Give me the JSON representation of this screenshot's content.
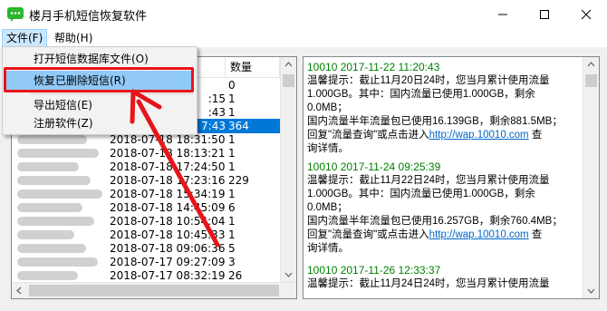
{
  "window": {
    "title": "楼月手机短信恢复软件",
    "accent": "#0078d7",
    "app_icon": "chat-bubble-icon"
  },
  "menubar": {
    "file": "文件(F)",
    "help": "帮助(H)"
  },
  "file_menu": {
    "items": [
      {
        "label": "打开短信数据库文件(O)"
      },
      {
        "label": "恢复已删除短信(R)"
      },
      {
        "label": "导出短信(E)"
      },
      {
        "label": "注册软件(Z)"
      }
    ]
  },
  "list": {
    "count_header": "数量",
    "rows": [
      {
        "date": "",
        "count": "0"
      },
      {
        "date": ":15",
        "count": "1"
      },
      {
        "date": ":43",
        "count": "1"
      },
      {
        "date": "7:43",
        "count": "364"
      },
      {
        "date": "2018-07-18 18:31:50",
        "count": "1"
      },
      {
        "date": "2018-07-18 18:13:21",
        "count": "1"
      },
      {
        "date": "2018-07-18 17:24:50",
        "count": "1"
      },
      {
        "date": "2018-07-18 17:23:16",
        "count": "229"
      },
      {
        "date": "2018-07-18 15:34:19",
        "count": "1"
      },
      {
        "date": "2018-07-18 14:45:09",
        "count": "6"
      },
      {
        "date": "2018-07-18 10:54:04",
        "count": "1"
      },
      {
        "date": "2018-07-18 10:45:33",
        "count": "1"
      },
      {
        "date": "2018-07-18 09:06:36",
        "count": "5"
      },
      {
        "date": "2018-07-17 09:27:09",
        "count": "3"
      },
      {
        "date": "2018-07-17 08:32:19",
        "count": "26"
      }
    ]
  },
  "messages": [
    {
      "header": "10010 2017-11-22 11:20:43",
      "line1": "温馨提示：截止11月20日24时，您当月累计使用流量",
      "line2": "1.000GB。其中：国内流量已使用1.000GB，剩余0.0MB；",
      "line3": "国内流量半年流量包已使用16.139GB，剩余881.5MB；",
      "line4_pre": "回复\"流量查询\"或点击进入",
      "link": "http://wap.10010.com",
      "line4_post": " 查",
      "line5": "询详情。"
    },
    {
      "header": "10010 2017-11-24 09:25:39",
      "line1": "温馨提示：截止11月22日24时，您当月累计使用流量",
      "line2": "1.000GB。其中：国内流量已使用1.000GB，剩余0.0MB；",
      "line3": "国内流量半年流量包已使用16.257GB，剩余760.4MB；",
      "line4_pre": "回复\"流量查询\"或点击进入",
      "link": "http://wap.10010.com",
      "line4_post": " 查",
      "line5": "询详情。"
    },
    {
      "header": "10010 2017-11-26 12:33:37",
      "line1": "温馨提示：截止11月24日24时，您当月累计使用流量"
    }
  ]
}
